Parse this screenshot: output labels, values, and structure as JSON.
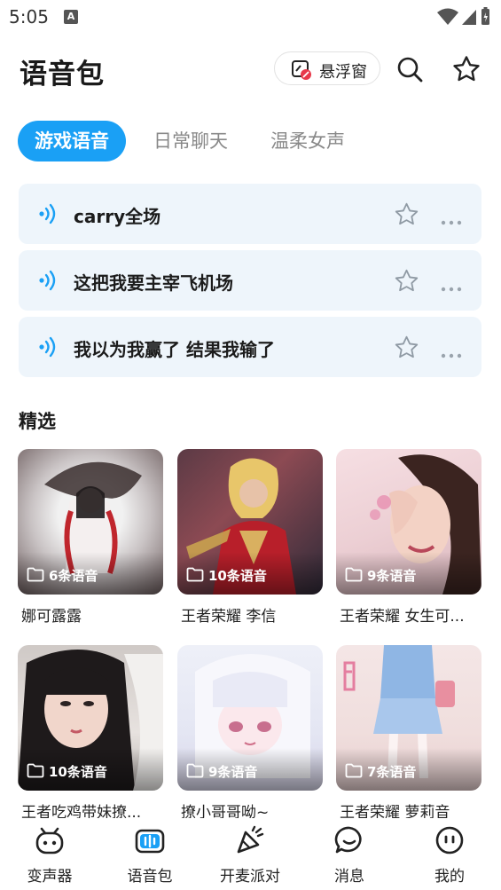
{
  "status_bar": {
    "time": "5:05",
    "notification_badge": "A",
    "icons": [
      "wifi-icon",
      "signal-icon",
      "battery-icon"
    ]
  },
  "header": {
    "title": "语音包",
    "float_window_label": "悬浮窗",
    "icons": [
      "float-window-icon",
      "search-icon",
      "star-icon"
    ]
  },
  "tabs": [
    {
      "label": "游戏语音",
      "active": true
    },
    {
      "label": "日常聊天",
      "active": false
    },
    {
      "label": "温柔女声",
      "active": false
    }
  ],
  "voices": [
    {
      "name": "carry全场"
    },
    {
      "name": "这把我要主宰飞机场"
    },
    {
      "name": "我以为我赢了 结果我输了"
    }
  ],
  "section": {
    "title": "精选"
  },
  "packs": [
    {
      "name": "娜可露露",
      "count": "6条语音"
    },
    {
      "name": "王者荣耀 李信",
      "count": "10条语音"
    },
    {
      "name": "王者荣耀 女生可...",
      "count": "9条语音"
    },
    {
      "name": "王者吃鸡带妹撩...",
      "count": "10条语音"
    },
    {
      "name": "撩小哥哥呦~",
      "count": "9条语音"
    },
    {
      "name": "王者荣耀 萝莉音",
      "count": "7条语音"
    }
  ],
  "bottom_nav": [
    {
      "label": "变声器",
      "icon": "robot-face-icon",
      "active": false
    },
    {
      "label": "语音包",
      "icon": "voice-pack-icon",
      "active": true
    },
    {
      "label": "开麦派对",
      "icon": "party-icon",
      "active": false
    },
    {
      "label": "消息",
      "icon": "message-icon",
      "active": false
    },
    {
      "label": "我的",
      "icon": "profile-icon",
      "active": false
    }
  ],
  "colors": {
    "accent": "#1aa0f5",
    "item_bg": "#eef5fb",
    "text": "#1a1a1a",
    "muted": "#888888"
  }
}
